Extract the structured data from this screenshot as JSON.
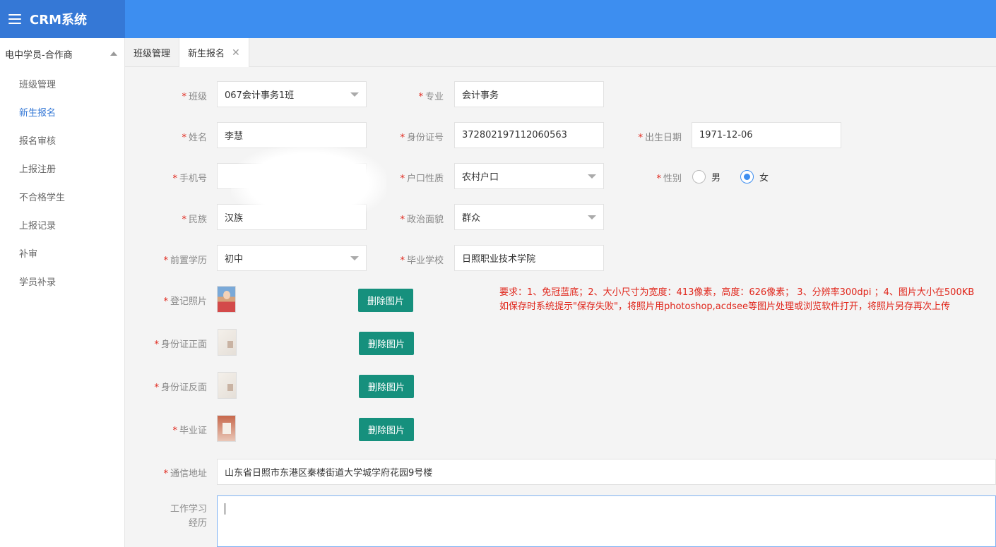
{
  "app": {
    "title": "CRM系统"
  },
  "sidebar": {
    "group_label": "电中学员-合作商",
    "items": [
      {
        "label": "班级管理"
      },
      {
        "label": "新生报名"
      },
      {
        "label": "报名审核"
      },
      {
        "label": "上报注册"
      },
      {
        "label": "不合格学生"
      },
      {
        "label": "上报记录"
      },
      {
        "label": "补审"
      },
      {
        "label": "学员补录"
      }
    ]
  },
  "tabs": [
    {
      "label": "班级管理"
    },
    {
      "label": "新生报名",
      "close": "✕"
    }
  ],
  "form": {
    "required_mark": "*",
    "class": {
      "label": "班级",
      "value": "067会计事务1班"
    },
    "major": {
      "label": "专业",
      "value": "会计事务"
    },
    "name": {
      "label": "姓名",
      "value": "李慧"
    },
    "id_number": {
      "label": "身份证号",
      "value": "372802197112060563"
    },
    "birth_date": {
      "label": "出生日期",
      "value": "1971-12-06"
    },
    "phone": {
      "label": "手机号",
      "value": ""
    },
    "hukou": {
      "label": "户口性质",
      "value": "农村户口"
    },
    "gender": {
      "label": "性别",
      "options": [
        "男",
        "女"
      ],
      "selected": "女"
    },
    "ethnicity": {
      "label": "民族",
      "value": "汉族"
    },
    "political": {
      "label": "政治面貌",
      "value": "群众"
    },
    "prior_edu": {
      "label": "前置学历",
      "value": "初中"
    },
    "grad_school": {
      "label": "毕业学校",
      "value": "日照职业技术学院"
    },
    "photo": {
      "label": "登记照片",
      "button": "删除图片"
    },
    "id_front": {
      "label": "身份证正面",
      "button": "删除图片"
    },
    "id_back": {
      "label": "身份证反面",
      "button": "删除图片"
    },
    "diploma": {
      "label": "毕业证",
      "button": "删除图片"
    },
    "address": {
      "label": "通信地址",
      "value": "山东省日照市东港区秦楼街道大学城学府花园9号楼"
    },
    "experience": {
      "label_line1": "工作学习",
      "label_line2": "经历",
      "value": ""
    },
    "notice_line1": "要求：1、免冠蓝底；2、大小尺寸为宽度：413像素，高度：626像素； 3、分辨率300dpi ；4、图片大小在500KB",
    "notice_line2": "如保存时系统提示\"保存失败\"，将照片用photoshop,acdsee等图片处理或浏览软件打开，将照片另存再次上传"
  }
}
